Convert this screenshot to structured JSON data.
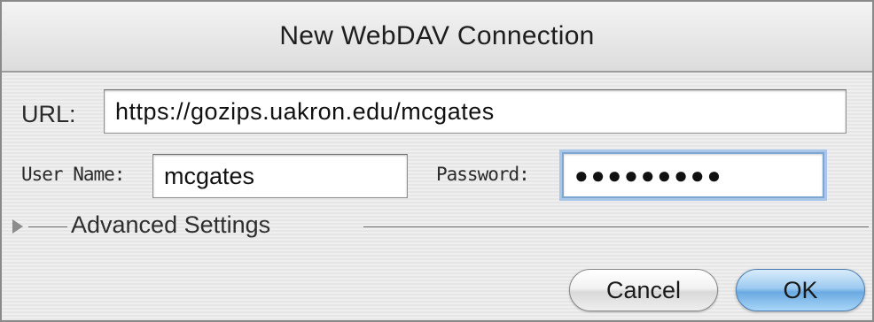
{
  "dialog": {
    "title": "New WebDAV Connection"
  },
  "form": {
    "url_label": "URL:",
    "url_value": "https://gozips.uakron.edu/mcgates",
    "username_label": "User Name:",
    "username_value": "mcgates",
    "password_label": "Password:",
    "password_masked": "●●●●●●●●●"
  },
  "advanced": {
    "label": "Advanced Settings",
    "icon": "disclosure-triangle-icon",
    "expanded": false
  },
  "buttons": {
    "cancel_label": "Cancel",
    "ok_label": "OK"
  },
  "colors": {
    "default_button": "#6aaae2",
    "focus_ring": "#a9c7e8"
  }
}
